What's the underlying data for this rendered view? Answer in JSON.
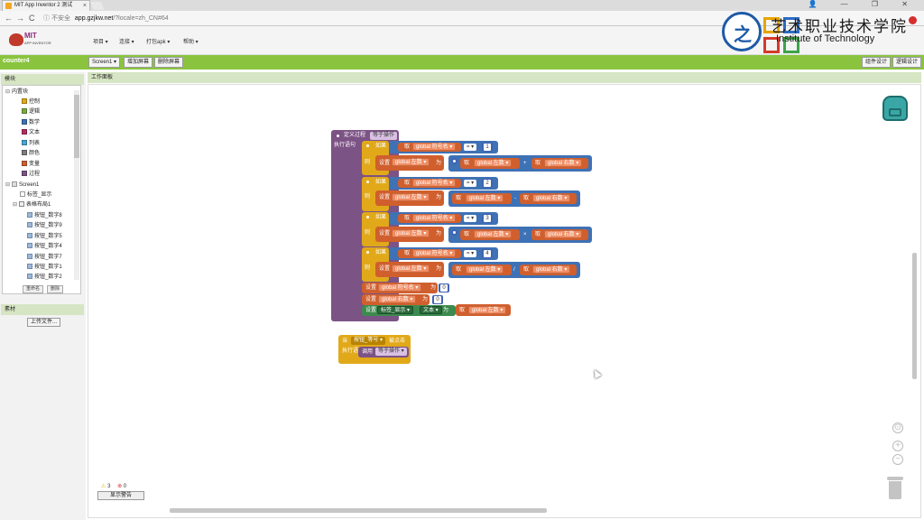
{
  "browser": {
    "tab_title": "MIT App Inventor 2 测试",
    "tab_close": "×",
    "window_controls": "👤 — ❐ ✕",
    "back": "←",
    "forward": "→",
    "reload": "C",
    "security": "ⓘ 不安全",
    "url_host": "app.gzjkw.net",
    "url_path": "/?locale=zh_CN#64"
  },
  "app": {
    "logo_title": "MIT",
    "logo_subtitle": "APP INVENTOR",
    "menu": [
      "项目 ▾",
      "连接 ▾",
      "打包apk ▾",
      "帮助 ▾"
    ]
  },
  "watermark": {
    "cn": "艺术职业技术学院",
    "en": "Institute of Technology",
    "colors": [
      "#e8a400",
      "#2b6cc4",
      "#d43b2b",
      "#3da34a"
    ]
  },
  "toolbar": {
    "project_name": "counter4",
    "screen_select": "Screen1 ▾",
    "add_screen": "增加屏幕",
    "remove_screen": "删除屏幕",
    "designer": "组件设计",
    "blocks": "逻辑设计"
  },
  "left": {
    "blocks_header": "模块",
    "builtin_label": "内置块",
    "builtin": [
      {
        "label": "控制",
        "color": "#e1a91a"
      },
      {
        "label": "逻辑",
        "color": "#77ab41"
      },
      {
        "label": "数学",
        "color": "#3f71b5"
      },
      {
        "label": "文本",
        "color": "#b32d5e"
      },
      {
        "label": "列表",
        "color": "#49a6d4"
      },
      {
        "label": "颜色",
        "color": "#7d7d7d"
      },
      {
        "label": "变量",
        "color": "#d05f2d"
      },
      {
        "label": "过程",
        "color": "#7c5385"
      }
    ],
    "screen_label": "Screen1",
    "components": [
      "标签_显示",
      "表格布局1"
    ],
    "buttons": [
      "按钮_数字8",
      "按钮_数字9",
      "按钮_数字5",
      "按钮_数字4",
      "按钮_数字7",
      "按钮_数字1",
      "按钮_数字2"
    ],
    "rename": "重命名",
    "delete": "删除",
    "media_header": "素材",
    "upload": "上传文件..."
  },
  "workspace": {
    "header": "工作面板",
    "warning_count": "3",
    "error_count": "0",
    "show_warnings": "显示警告",
    "zoom_reset": "⊙",
    "zoom_in": "+",
    "zoom_out": "−"
  },
  "blocks": {
    "proc_define": "定义过程",
    "proc_name": "等于操作",
    "do_label": "执行语句",
    "if_label": "如果",
    "then_label": "则",
    "get": "取",
    "set": "设置",
    "to": "为",
    "global_op": "global 符号名 ▾",
    "global_left": "global 左数 ▾",
    "global_right": "global 右数 ▾",
    "eq": "= ▾",
    "conds": [
      "1",
      "2",
      "3",
      "4"
    ],
    "ops": [
      "+",
      "-",
      "×",
      "/"
    ],
    "reset_val": "0",
    "label_comp": "标签_显示 ▾",
    "text_prop": "文本 ▾",
    "when": "当",
    "event_comp": "按钮_等号 ▾",
    "event_name": "被点击",
    "call": "调用",
    "call_name": "等于操作 ▾"
  }
}
